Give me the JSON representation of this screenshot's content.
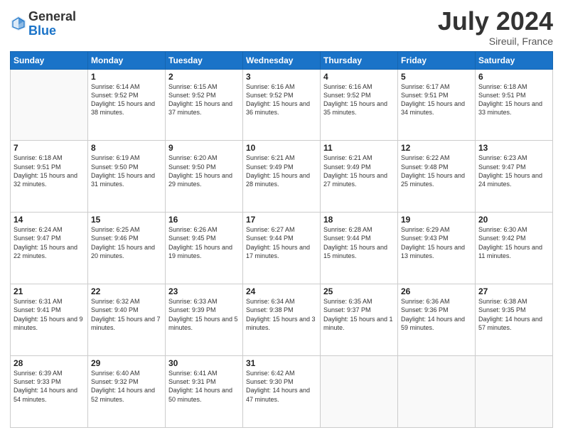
{
  "logo": {
    "general": "General",
    "blue": "Blue"
  },
  "title": "July 2024",
  "location": "Sireuil, France",
  "days_of_week": [
    "Sunday",
    "Monday",
    "Tuesday",
    "Wednesday",
    "Thursday",
    "Friday",
    "Saturday"
  ],
  "weeks": [
    [
      {
        "day": "",
        "info": ""
      },
      {
        "day": "1",
        "info": "Sunrise: 6:14 AM\nSunset: 9:52 PM\nDaylight: 15 hours\nand 38 minutes."
      },
      {
        "day": "2",
        "info": "Sunrise: 6:15 AM\nSunset: 9:52 PM\nDaylight: 15 hours\nand 37 minutes."
      },
      {
        "day": "3",
        "info": "Sunrise: 6:16 AM\nSunset: 9:52 PM\nDaylight: 15 hours\nand 36 minutes."
      },
      {
        "day": "4",
        "info": "Sunrise: 6:16 AM\nSunset: 9:52 PM\nDaylight: 15 hours\nand 35 minutes."
      },
      {
        "day": "5",
        "info": "Sunrise: 6:17 AM\nSunset: 9:51 PM\nDaylight: 15 hours\nand 34 minutes."
      },
      {
        "day": "6",
        "info": "Sunrise: 6:18 AM\nSunset: 9:51 PM\nDaylight: 15 hours\nand 33 minutes."
      }
    ],
    [
      {
        "day": "7",
        "info": "Sunrise: 6:18 AM\nSunset: 9:51 PM\nDaylight: 15 hours\nand 32 minutes."
      },
      {
        "day": "8",
        "info": "Sunrise: 6:19 AM\nSunset: 9:50 PM\nDaylight: 15 hours\nand 31 minutes."
      },
      {
        "day": "9",
        "info": "Sunrise: 6:20 AM\nSunset: 9:50 PM\nDaylight: 15 hours\nand 29 minutes."
      },
      {
        "day": "10",
        "info": "Sunrise: 6:21 AM\nSunset: 9:49 PM\nDaylight: 15 hours\nand 28 minutes."
      },
      {
        "day": "11",
        "info": "Sunrise: 6:21 AM\nSunset: 9:49 PM\nDaylight: 15 hours\nand 27 minutes."
      },
      {
        "day": "12",
        "info": "Sunrise: 6:22 AM\nSunset: 9:48 PM\nDaylight: 15 hours\nand 25 minutes."
      },
      {
        "day": "13",
        "info": "Sunrise: 6:23 AM\nSunset: 9:47 PM\nDaylight: 15 hours\nand 24 minutes."
      }
    ],
    [
      {
        "day": "14",
        "info": "Sunrise: 6:24 AM\nSunset: 9:47 PM\nDaylight: 15 hours\nand 22 minutes."
      },
      {
        "day": "15",
        "info": "Sunrise: 6:25 AM\nSunset: 9:46 PM\nDaylight: 15 hours\nand 20 minutes."
      },
      {
        "day": "16",
        "info": "Sunrise: 6:26 AM\nSunset: 9:45 PM\nDaylight: 15 hours\nand 19 minutes."
      },
      {
        "day": "17",
        "info": "Sunrise: 6:27 AM\nSunset: 9:44 PM\nDaylight: 15 hours\nand 17 minutes."
      },
      {
        "day": "18",
        "info": "Sunrise: 6:28 AM\nSunset: 9:44 PM\nDaylight: 15 hours\nand 15 minutes."
      },
      {
        "day": "19",
        "info": "Sunrise: 6:29 AM\nSunset: 9:43 PM\nDaylight: 15 hours\nand 13 minutes."
      },
      {
        "day": "20",
        "info": "Sunrise: 6:30 AM\nSunset: 9:42 PM\nDaylight: 15 hours\nand 11 minutes."
      }
    ],
    [
      {
        "day": "21",
        "info": "Sunrise: 6:31 AM\nSunset: 9:41 PM\nDaylight: 15 hours\nand 9 minutes."
      },
      {
        "day": "22",
        "info": "Sunrise: 6:32 AM\nSunset: 9:40 PM\nDaylight: 15 hours\nand 7 minutes."
      },
      {
        "day": "23",
        "info": "Sunrise: 6:33 AM\nSunset: 9:39 PM\nDaylight: 15 hours\nand 5 minutes."
      },
      {
        "day": "24",
        "info": "Sunrise: 6:34 AM\nSunset: 9:38 PM\nDaylight: 15 hours\nand 3 minutes."
      },
      {
        "day": "25",
        "info": "Sunrise: 6:35 AM\nSunset: 9:37 PM\nDaylight: 15 hours\nand 1 minute."
      },
      {
        "day": "26",
        "info": "Sunrise: 6:36 AM\nSunset: 9:36 PM\nDaylight: 14 hours\nand 59 minutes."
      },
      {
        "day": "27",
        "info": "Sunrise: 6:38 AM\nSunset: 9:35 PM\nDaylight: 14 hours\nand 57 minutes."
      }
    ],
    [
      {
        "day": "28",
        "info": "Sunrise: 6:39 AM\nSunset: 9:33 PM\nDaylight: 14 hours\nand 54 minutes."
      },
      {
        "day": "29",
        "info": "Sunrise: 6:40 AM\nSunset: 9:32 PM\nDaylight: 14 hours\nand 52 minutes."
      },
      {
        "day": "30",
        "info": "Sunrise: 6:41 AM\nSunset: 9:31 PM\nDaylight: 14 hours\nand 50 minutes."
      },
      {
        "day": "31",
        "info": "Sunrise: 6:42 AM\nSunset: 9:30 PM\nDaylight: 14 hours\nand 47 minutes."
      },
      {
        "day": "",
        "info": ""
      },
      {
        "day": "",
        "info": ""
      },
      {
        "day": "",
        "info": ""
      }
    ]
  ]
}
